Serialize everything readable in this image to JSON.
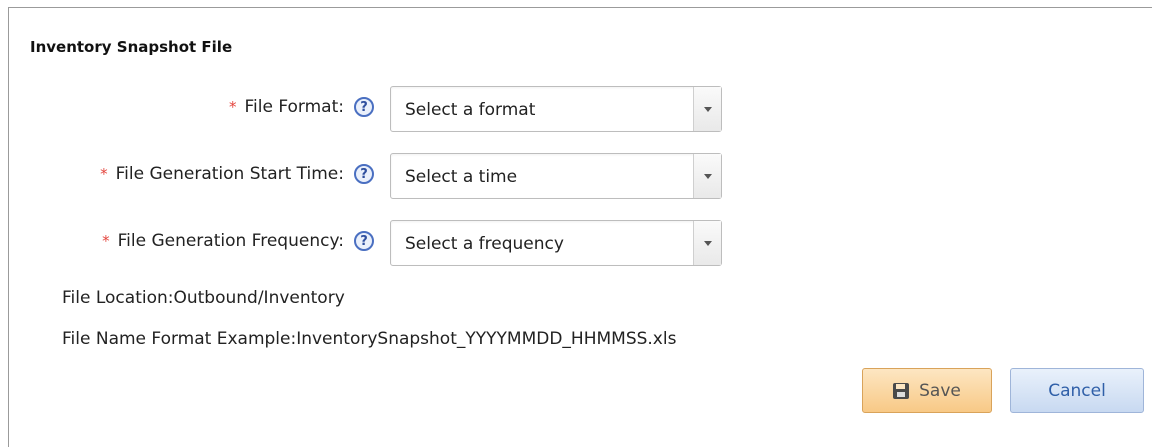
{
  "section": {
    "title": "Inventory Snapshot File"
  },
  "fields": [
    {
      "required": "*",
      "label": "File Format:",
      "help_icon": "?",
      "selected": "Select a format"
    },
    {
      "required": "*",
      "label": "File Generation Start Time:",
      "help_icon": "?",
      "selected": "Select a time"
    },
    {
      "required": "*",
      "label": "File Generation Frequency:",
      "help_icon": "?",
      "selected": "Select a frequency"
    }
  ],
  "info": {
    "location": "File Location:Outbound/Inventory",
    "name_format": "File Name Format Example:InventorySnapshot_YYYYMMDD_HHMMSS.xls"
  },
  "buttons": {
    "save": "Save",
    "cancel": "Cancel"
  },
  "colors": {
    "required": "#e4463f",
    "save_bg": "#f8c986",
    "cancel_text": "#2f5fa8"
  },
  "icons": {
    "help": "question-circle-icon",
    "save": "floppy-disk-icon",
    "dropdown": "chevron-down-icon"
  }
}
